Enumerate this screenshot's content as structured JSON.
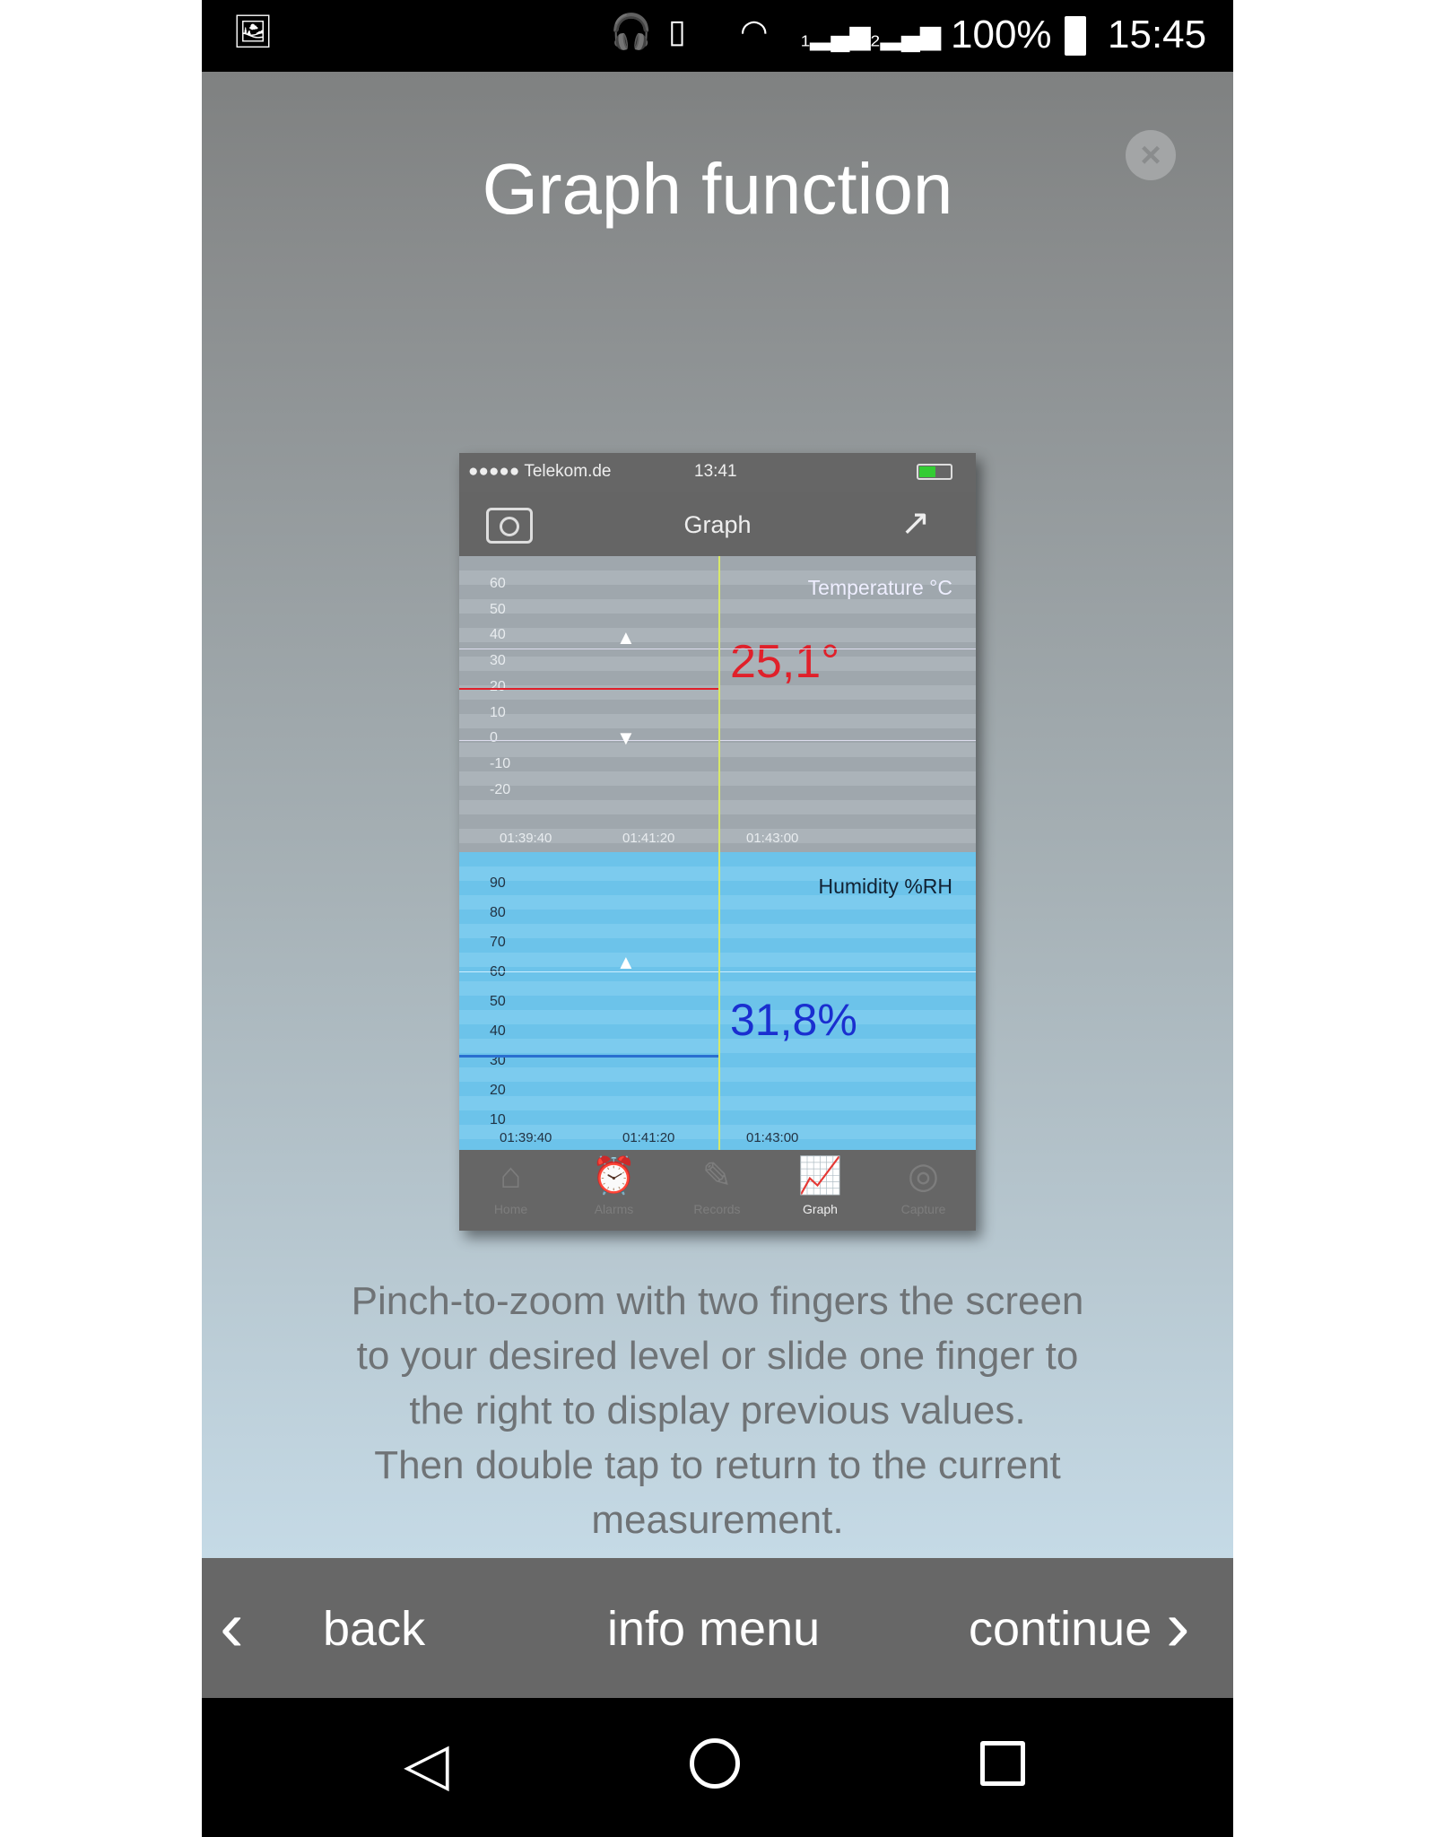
{
  "status_bar": {
    "battery": "100%",
    "time": "15:45",
    "icons": [
      "image-icon",
      "headset-icon",
      "vibrate-icon",
      "wifi-icon",
      "signal-1-icon",
      "signal-2-icon",
      "battery-icon"
    ]
  },
  "title": "Graph function",
  "close_icon": "close-icon",
  "phone": {
    "status": {
      "carrier": "●●●●● Telekom.de",
      "time": "13:41"
    },
    "nav": {
      "title": "Graph"
    },
    "temperature": {
      "label": "Temperature °C",
      "value": "25,1°",
      "color": "#e0202a",
      "ticks": [
        "60",
        "50",
        "40",
        "30",
        "20",
        "10",
        "0",
        "-10",
        "-20"
      ],
      "x_ticks": [
        "01:39:40",
        "01:41:20",
        "01:43:00"
      ]
    },
    "humidity": {
      "label": "Humidity %RH",
      "value": "31,8%",
      "color": "#1a2fd0",
      "ticks": [
        "90",
        "80",
        "70",
        "60",
        "50",
        "40",
        "30",
        "20",
        "10"
      ],
      "x_ticks": [
        "01:39:40",
        "01:41:20",
        "01:43:00"
      ]
    },
    "tabs": [
      {
        "label": "Home",
        "icon": "⌂"
      },
      {
        "label": "Alarms",
        "icon": "⏰"
      },
      {
        "label": "Records",
        "icon": "✎"
      },
      {
        "label": "Graph",
        "icon": "📈",
        "active": true
      },
      {
        "label": "Capture",
        "icon": "◎"
      }
    ]
  },
  "instructions": [
    "Pinch-to-zoom with two fingers the screen",
    "to your desired level or slide one finger to",
    "the right to display previous values.",
    "Then double tap to return to the current",
    "measurement."
  ],
  "bottom": {
    "back": "back",
    "info": "info menu",
    "continue": "continue"
  }
}
